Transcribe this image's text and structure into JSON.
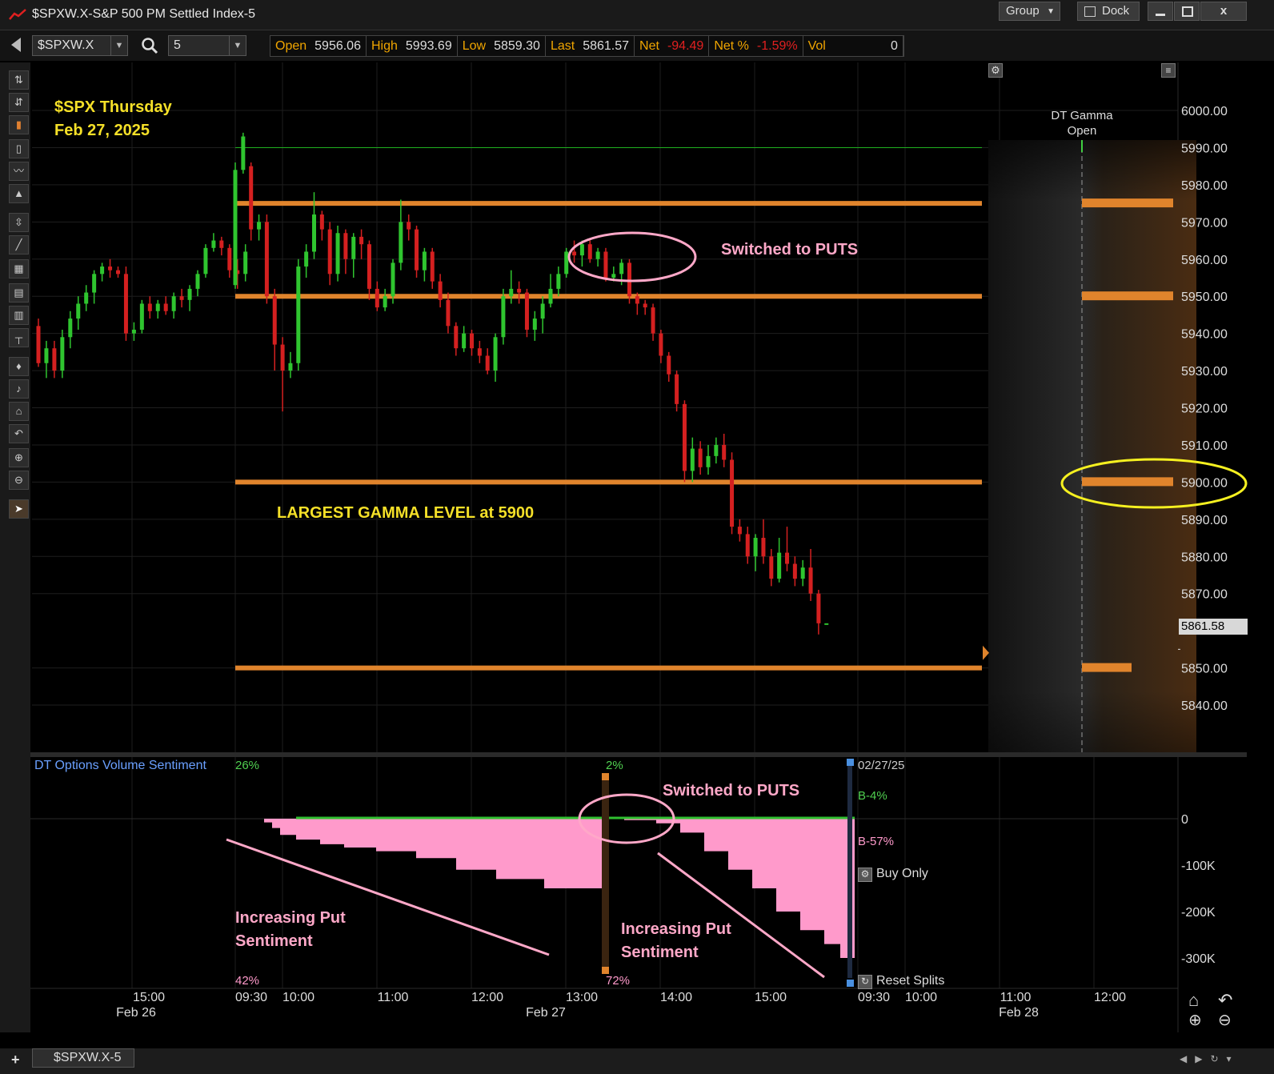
{
  "window": {
    "title": "$SPXW.X-S&P 500 PM Settled Index-5",
    "group_label": "Group",
    "dock_label": "Dock",
    "minimize_icon": "minimize-icon",
    "maximize_icon": "maximize-icon",
    "close_label": "x"
  },
  "toolbar": {
    "symbol": "$SPXW.X",
    "interval": "5",
    "quote": [
      {
        "label": "Open",
        "value": "5956.06",
        "color": "#dddddd"
      },
      {
        "label": "High",
        "value": "5993.69",
        "color": "#dddddd"
      },
      {
        "label": "Low",
        "value": "5859.30",
        "color": "#dddddd"
      },
      {
        "label": "Last",
        "value": "5861.57",
        "color": "#dddddd"
      },
      {
        "label": "Net",
        "value": "-94.49",
        "color": "#e02020"
      },
      {
        "label": "Net %",
        "value": "-1.59%",
        "color": "#e02020"
      },
      {
        "label": "Vol",
        "value": "0",
        "color": "#dddddd"
      }
    ]
  },
  "annotations": {
    "title_line1": "$SPX Thursday",
    "title_line2": "Feb 27, 2025",
    "switched_puts_top": "Switched to PUTS",
    "largest_gamma": "LARGEST GAMMA LEVEL at 5900",
    "switched_puts_bottom": "Switched to PUTS",
    "increasing_put_1_line1": "Increasing Put",
    "increasing_put_1_line2": "Sentiment",
    "increasing_put_2_line1": "Increasing Put",
    "increasing_put_2_line2": "Sentiment"
  },
  "gamma_panel": {
    "header_line1": "DT Gamma",
    "header_line2": "Open"
  },
  "last_price_tag": "5861.58",
  "sentiment_panel": {
    "title": "DT Options Volume Sentiment",
    "pct_top_left": "26%",
    "pct_bottom_left": "42%",
    "pct_top_mid": "2%",
    "pct_bottom_mid": "72%",
    "date": "02/27/25",
    "buy_pct": "B-4%",
    "buy_pct2": "B-57%",
    "buy_only": "Buy Only",
    "reset_splits": "Reset Splits",
    "yticks": [
      "0",
      "-100K",
      "-200K",
      "-300K"
    ]
  },
  "xaxis": {
    "ticks": [
      {
        "t": "15:00",
        "x": 186
      },
      {
        "t": "09:30",
        "x": 314
      },
      {
        "t": "10:00",
        "x": 373
      },
      {
        "t": "11:00",
        "x": 491
      },
      {
        "t": "12:00",
        "x": 609
      },
      {
        "t": "13:00",
        "x": 727
      },
      {
        "t": "14:00",
        "x": 845
      },
      {
        "t": "15:00",
        "x": 963
      },
      {
        "t": "09:30",
        "x": 1092
      },
      {
        "t": "10:00",
        "x": 1151
      },
      {
        "t": "11:00",
        "x": 1269
      },
      {
        "t": "12:00",
        "x": 1387
      }
    ],
    "dates": [
      {
        "t": "Feb 26",
        "x": 170
      },
      {
        "t": "Feb 27",
        "x": 682
      },
      {
        "t": "Feb 28",
        "x": 1273
      }
    ]
  },
  "tab": {
    "label": "$SPXW.X-5"
  },
  "chart_data": {
    "type": "candlestick",
    "yticks": [
      6000,
      5990,
      5980,
      5970,
      5960,
      5950,
      5940,
      5930,
      5920,
      5910,
      5900,
      5890,
      5880,
      5870,
      5850,
      5840
    ],
    "ylim": [
      5821,
      6007
    ],
    "gamma_levels": [
      5975,
      5950,
      5900,
      5850
    ],
    "hline_green": 5990,
    "candles": [
      [
        5942,
        5932,
        5944,
        5931
      ],
      [
        5932,
        5936,
        5938,
        5928
      ],
      [
        5936,
        5930,
        5938,
        5928
      ],
      [
        5930,
        5939,
        5941,
        5928
      ],
      [
        5939,
        5944,
        5946,
        5936
      ],
      [
        5944,
        5948,
        5950,
        5941
      ],
      [
        5948,
        5951,
        5953,
        5946
      ],
      [
        5951,
        5956,
        5957,
        5948
      ],
      [
        5956,
        5958,
        5959,
        5954
      ],
      [
        5958,
        5957,
        5960,
        5955
      ],
      [
        5957,
        5956,
        5958,
        5955
      ],
      [
        5956,
        5940,
        5958,
        5938
      ],
      [
        5940,
        5941,
        5943,
        5938
      ],
      [
        5941,
        5948,
        5949,
        5940
      ],
      [
        5948,
        5946,
        5950,
        5944
      ],
      [
        5946,
        5948,
        5949,
        5944
      ],
      [
        5948,
        5946,
        5950,
        5945
      ],
      [
        5946,
        5950,
        5951,
        5944
      ],
      [
        5950,
        5949,
        5952,
        5947
      ],
      [
        5949,
        5952,
        5953,
        5946
      ],
      [
        5952,
        5956,
        5957,
        5950
      ],
      [
        5956,
        5963,
        5964,
        5955
      ],
      [
        5963,
        5965,
        5967,
        5962
      ],
      [
        5965,
        5963,
        5966,
        5961
      ],
      [
        5963,
        5957,
        5964,
        5955
      ],
      [
        5957,
        5956,
        5960,
        5952
      ],
      [
        5956,
        5962,
        5964,
        5954
      ],
      [
        5953,
        5984,
        5986,
        5952
      ],
      [
        5984,
        5993,
        5994,
        5983
      ],
      [
        5985,
        5968,
        5986,
        5965
      ],
      [
        5968,
        5970,
        5972,
        5965
      ],
      [
        5970,
        5950,
        5972,
        5948
      ],
      [
        5950,
        5937,
        5952,
        5930
      ],
      [
        5937,
        5930,
        5939,
        5919
      ],
      [
        5930,
        5932,
        5935,
        5928
      ],
      [
        5932,
        5958,
        5960,
        5930
      ],
      [
        5958,
        5962,
        5964,
        5955
      ],
      [
        5962,
        5972,
        5978,
        5960
      ],
      [
        5972,
        5968,
        5973,
        5965
      ],
      [
        5968,
        5956,
        5970,
        5953
      ],
      [
        5956,
        5967,
        5969,
        5954
      ],
      [
        5967,
        5960,
        5968,
        5956
      ],
      [
        5960,
        5966,
        5967,
        5955
      ],
      [
        5966,
        5964,
        5968,
        5960
      ],
      [
        5964,
        5952,
        5965,
        5949
      ],
      [
        5952,
        5947,
        5954,
        5946
      ],
      [
        5947,
        5950,
        5952,
        5946
      ],
      [
        5950,
        5959,
        5960,
        5948
      ],
      [
        5959,
        5970,
        5976,
        5957
      ],
      [
        5970,
        5968,
        5972,
        5965
      ],
      [
        5968,
        5957,
        5969,
        5955
      ],
      [
        5957,
        5962,
        5963,
        5954
      ],
      [
        5962,
        5954,
        5963,
        5952
      ],
      [
        5954,
        5949,
        5956,
        5947
      ],
      [
        5949,
        5942,
        5951,
        5940
      ],
      [
        5942,
        5936,
        5943,
        5934
      ],
      [
        5936,
        5940,
        5942,
        5935
      ],
      [
        5940,
        5936,
        5941,
        5934
      ],
      [
        5936,
        5934,
        5938,
        5932
      ],
      [
        5934,
        5930,
        5936,
        5929
      ],
      [
        5930,
        5939,
        5940,
        5927
      ],
      [
        5939,
        5950,
        5952,
        5937
      ],
      [
        5950,
        5952,
        5957,
        5948
      ],
      [
        5952,
        5951,
        5954,
        5948
      ],
      [
        5951,
        5941,
        5952,
        5939
      ],
      [
        5941,
        5944,
        5946,
        5938
      ],
      [
        5944,
        5948,
        5950,
        5940
      ],
      [
        5948,
        5952,
        5956,
        5947
      ],
      [
        5952,
        5956,
        5958,
        5950
      ],
      [
        5956,
        5962,
        5963,
        5955
      ],
      [
        5962,
        5961,
        5965,
        5959
      ],
      [
        5961,
        5964,
        5965,
        5958
      ],
      [
        5964,
        5960,
        5965,
        5959
      ],
      [
        5960,
        5962,
        5963,
        5958
      ],
      [
        5962,
        5955,
        5963,
        5954
      ],
      [
        5955,
        5956,
        5958,
        5954
      ],
      [
        5956,
        5959,
        5960,
        5953
      ],
      [
        5959,
        5950,
        5960,
        5948
      ],
      [
        5950,
        5948,
        5951,
        5945
      ],
      [
        5948,
        5947,
        5949,
        5945
      ],
      [
        5947,
        5940,
        5948,
        5938
      ],
      [
        5940,
        5934,
        5941,
        5932
      ],
      [
        5934,
        5929,
        5935,
        5927
      ],
      [
        5929,
        5921,
        5930,
        5919
      ],
      [
        5921,
        5903,
        5922,
        5900
      ],
      [
        5903,
        5909,
        5912,
        5900
      ],
      [
        5909,
        5904,
        5911,
        5902
      ],
      [
        5904,
        5907,
        5910,
        5902
      ],
      [
        5907,
        5910,
        5912,
        5905
      ],
      [
        5910,
        5906,
        5913,
        5904
      ],
      [
        5906,
        5888,
        5908,
        5886
      ],
      [
        5888,
        5886,
        5890,
        5884
      ],
      [
        5886,
        5880,
        5888,
        5878
      ],
      [
        5880,
        5885,
        5886,
        5876
      ],
      [
        5885,
        5880,
        5890,
        5878
      ],
      [
        5880,
        5874,
        5882,
        5872
      ],
      [
        5874,
        5881,
        5885,
        5873
      ],
      [
        5881,
        5878,
        5888,
        5876
      ],
      [
        5878,
        5874,
        5880,
        5872
      ],
      [
        5874,
        5877,
        5879,
        5872
      ],
      [
        5877,
        5870,
        5882,
        5868
      ],
      [
        5870,
        5862,
        5871,
        5859
      ],
      [
        5862,
        5862,
        5862,
        5862
      ]
    ],
    "sentiment": {
      "ylim": [
        -360000,
        10000
      ],
      "put_curve_day1": [
        [
          290,
          0
        ],
        [
          318,
          0
        ],
        [
          330,
          -8000
        ],
        [
          340,
          -20000
        ],
        [
          350,
          -35000
        ],
        [
          370,
          -45000
        ],
        [
          400,
          -55000
        ],
        [
          430,
          -62000
        ],
        [
          470,
          -70000
        ],
        [
          520,
          -85000
        ],
        [
          570,
          -110000
        ],
        [
          620,
          -130000
        ],
        [
          680,
          -150000
        ],
        [
          752,
          -155000
        ]
      ],
      "put_curve_day2": [
        [
          752,
          0
        ],
        [
          780,
          -3000
        ],
        [
          820,
          -10000
        ],
        [
          850,
          -30000
        ],
        [
          880,
          -70000
        ],
        [
          910,
          -110000
        ],
        [
          940,
          -150000
        ],
        [
          970,
          -200000
        ],
        [
          1000,
          -240000
        ],
        [
          1030,
          -270000
        ],
        [
          1050,
          -300000
        ],
        [
          1068,
          -330000
        ]
      ]
    }
  }
}
